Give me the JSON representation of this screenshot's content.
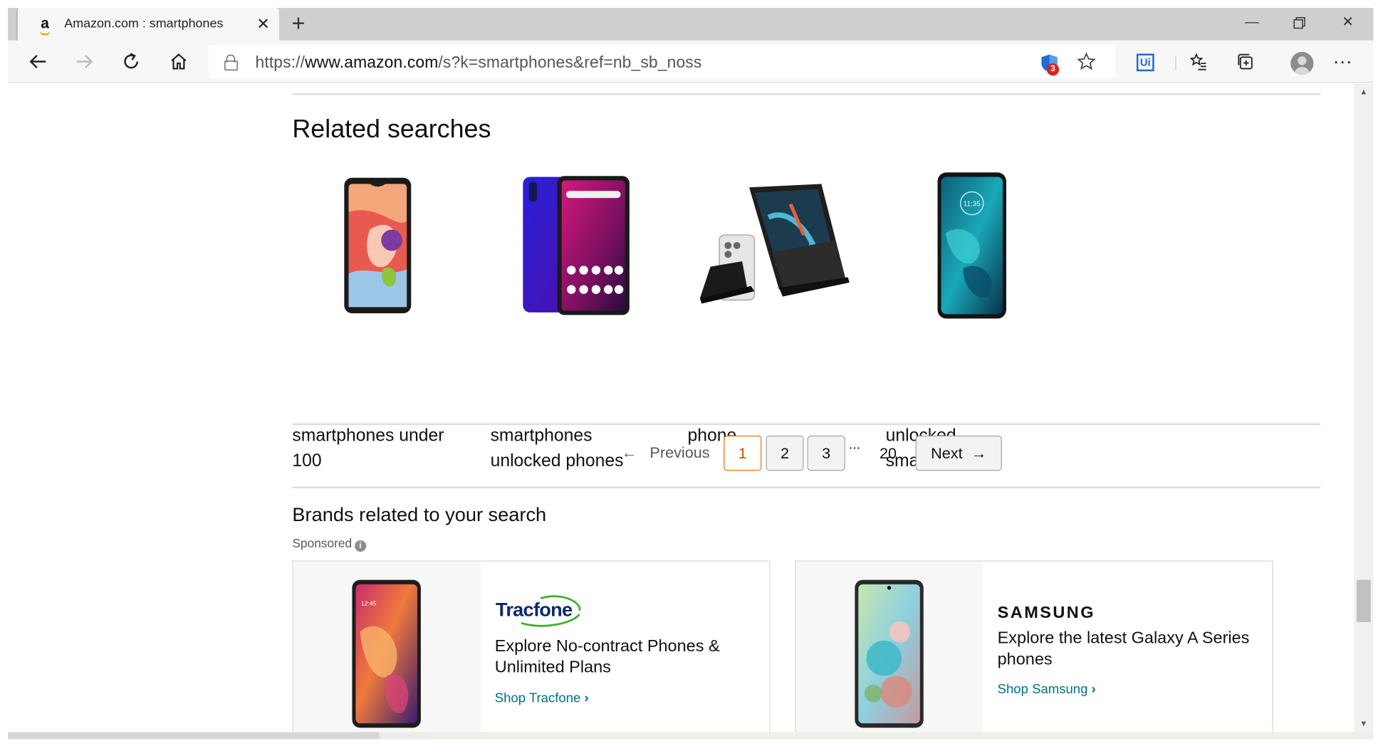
{
  "browser": {
    "tab_title": "Amazon.com : smartphones",
    "tab_favicon": "a",
    "url_prefix": "https://",
    "url_host": "www.amazon.com",
    "url_path": "/s?k=smartphones&ref=nb_sb_noss",
    "extension_badge_count": "3",
    "extension_ui_label": "Ui"
  },
  "related": {
    "heading": "Related searches",
    "items": [
      {
        "label": "smartphones under 100",
        "icon": "phone-image"
      },
      {
        "label": "smartphones unlocked phones",
        "icon": "phone-image"
      },
      {
        "label": "phone",
        "icon": "phone-stand-image"
      },
      {
        "label": "unlocked smartphones",
        "icon": "phone-image"
      }
    ]
  },
  "pagination": {
    "previous": "Previous",
    "pages": [
      "1",
      "2",
      "3"
    ],
    "current": "1",
    "ellipsis": "...",
    "last": "20",
    "next": "Next"
  },
  "brands": {
    "heading": "Brands related to your search",
    "sponsored": "Sponsored",
    "cards": [
      {
        "logo": "Tracfone",
        "headline": "Explore No-contract Phones & Unlimited Plans",
        "link": "Shop Tracfone"
      },
      {
        "logo": "SAMSUNG",
        "headline": "Explore the latest Galaxy A Series phones",
        "link": "Shop Samsung"
      }
    ]
  },
  "colors": {
    "link": "#007185",
    "current_page": "#c45500",
    "current_page_border": "#e77600",
    "tracfone_green": "#3fae2a",
    "tracfone_navy": "#0a2a6b"
  }
}
